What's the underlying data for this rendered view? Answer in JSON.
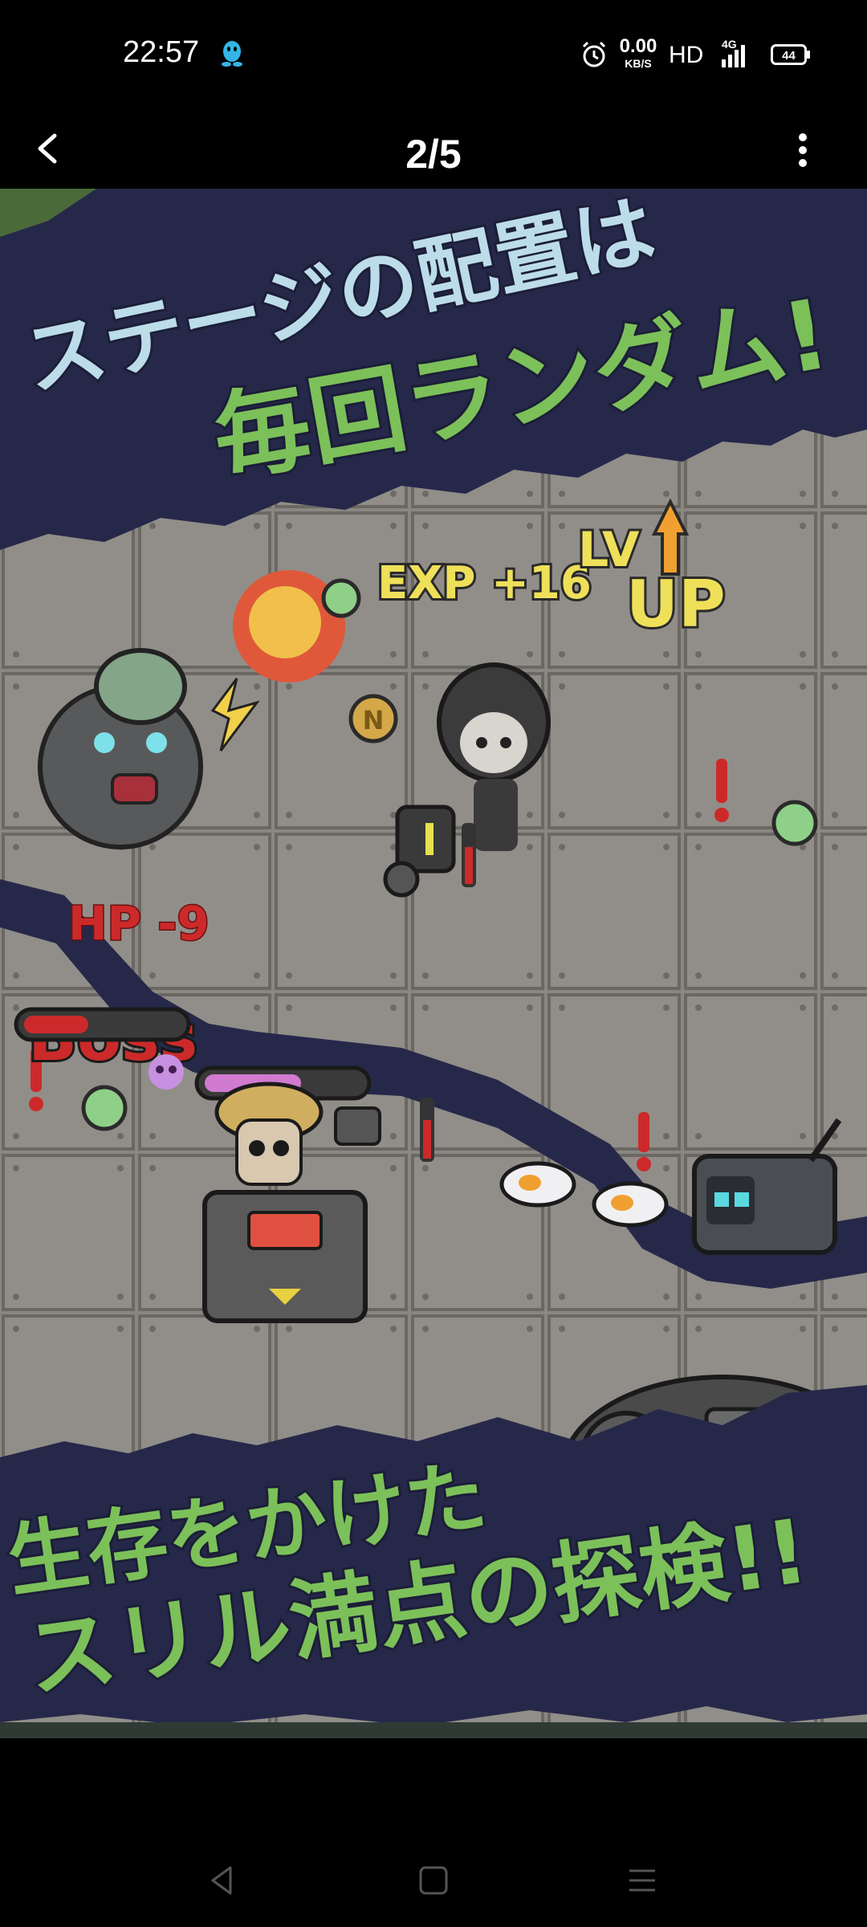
{
  "status_bar": {
    "time": "22:57",
    "net_speed_value": "0.00",
    "net_speed_unit": "KB/S",
    "hd_label": "HD",
    "network_type": "4G",
    "battery_level": "44"
  },
  "app_bar": {
    "page_counter": "2/5"
  },
  "image": {
    "headline_line1": "ステージの配置は",
    "headline_line2": "毎回ランダム!",
    "exp_text": "EXP +16",
    "lvup_lv": "LV",
    "lvup_up": "UP",
    "hp_text": "HP -9",
    "boss_text": "Boss",
    "coin_letter": "N",
    "footer_line1": "生存をかけた",
    "footer_line2": "スリル満点の探検!!"
  },
  "colors": {
    "banner": "#26284a",
    "headline_blue": "#bcdcea",
    "headline_green": "#7cc05a",
    "floor": "#8a8782",
    "exp_yellow": "#efe05a",
    "hp_red": "#cc2a2a"
  }
}
